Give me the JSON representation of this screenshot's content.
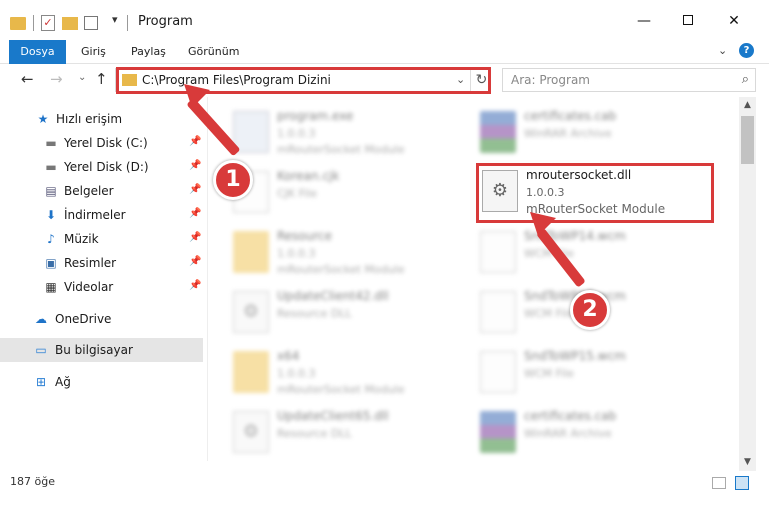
{
  "window": {
    "title": "Program",
    "minimize": "—",
    "close": "✕"
  },
  "ribbon": {
    "tabs": [
      "Dosya",
      "Giriş",
      "Paylaş",
      "Görünüm"
    ]
  },
  "navbar": {
    "address": "C:\\Program Files\\Program Dizini",
    "search_placeholder": "Ara: Program"
  },
  "sidebar": {
    "items": [
      {
        "label": "Hızlı erişim",
        "icon": "star-icon"
      },
      {
        "label": "Yerel Disk (C:)",
        "icon": "drive-icon",
        "pinned": true
      },
      {
        "label": "Yerel Disk (D:)",
        "icon": "drive-icon",
        "pinned": true
      },
      {
        "label": "Belgeler",
        "icon": "documents-icon",
        "pinned": true
      },
      {
        "label": "İndirmeler",
        "icon": "download-icon",
        "pinned": true
      },
      {
        "label": "Müzik",
        "icon": "music-icon",
        "pinned": true
      },
      {
        "label": "Resimler",
        "icon": "pictures-icon",
        "pinned": true
      },
      {
        "label": "Videolar",
        "icon": "videos-icon",
        "pinned": true
      },
      {
        "label": "OneDrive",
        "icon": "cloud-icon"
      },
      {
        "label": "Bu bilgisayar",
        "icon": "computer-icon",
        "selected": true
      },
      {
        "label": "Ağ",
        "icon": "network-icon"
      }
    ]
  },
  "files": {
    "left": [
      {
        "name": "program.exe",
        "line2": "1.0.0.3",
        "line3": "mRouterSocket Module",
        "icon": "exe"
      },
      {
        "name": "Korean.cjk",
        "line2": "CJK File",
        "line3": "",
        "icon": "doc"
      },
      {
        "name": "Resource",
        "line2": "1.0.0.3",
        "line3": "mRouterSocket Module",
        "icon": "folder"
      },
      {
        "name": "UpdateClient42.dll",
        "line2": "Resource DLL",
        "line3": "",
        "icon": "gear"
      },
      {
        "name": "x64",
        "line2": "1.0.0.3",
        "line3": "mRouterSocket Module",
        "icon": "folder"
      },
      {
        "name": "UpdateClient65.dll",
        "line2": "Resource DLL",
        "line3": "",
        "icon": "gear"
      }
    ],
    "right": [
      {
        "name": "certificates.cab",
        "line2": "WinRAR Archive",
        "line3": "",
        "icon": "rar"
      },
      {
        "name": "SndToWP14.wcm",
        "line2": "WCM File",
        "line3": "",
        "icon": "doc"
      },
      {
        "name": "SndToWP10.wcm",
        "line2": "WCM File",
        "line3": "",
        "icon": "doc"
      },
      {
        "name": "SndToWP15.wcm",
        "line2": "WCM File",
        "line3": "",
        "icon": "doc"
      },
      {
        "name": "certificates.cab",
        "line2": "WinRAR Archive",
        "line3": "",
        "icon": "rar"
      }
    ],
    "focused": {
      "name": "mroutersocket.dll",
      "version": "1.0.0.3",
      "type": "mRouterSocket Module"
    }
  },
  "status": {
    "count": "187 öğe"
  },
  "annotations": {
    "step1": "1",
    "step2": "2",
    "color": "#d83a3a"
  }
}
